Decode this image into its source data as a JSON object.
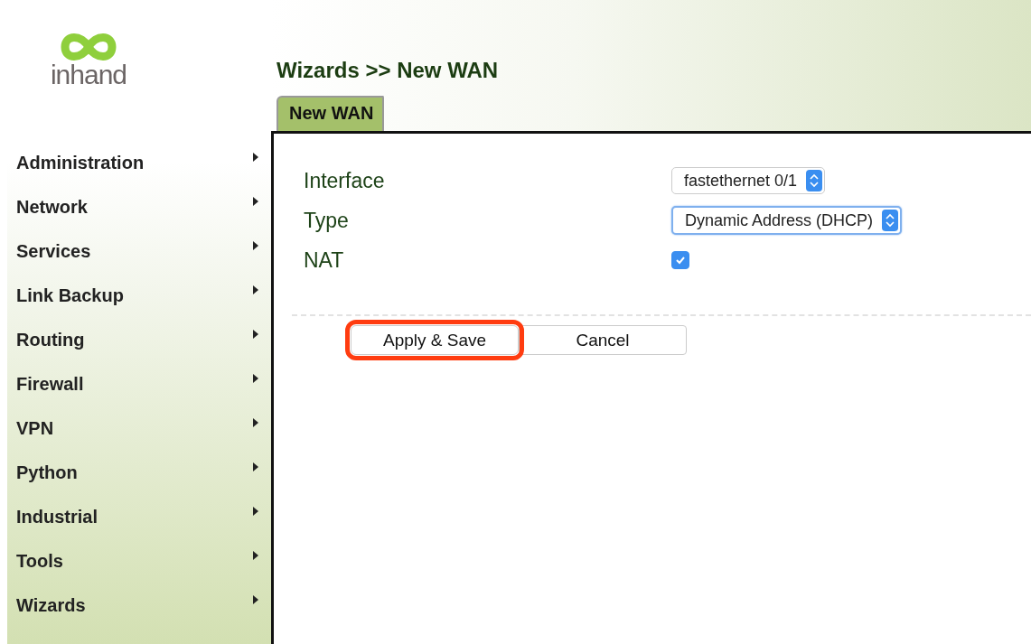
{
  "logo": {
    "text": "inhand"
  },
  "sidebar": {
    "items": [
      {
        "label": "Administration"
      },
      {
        "label": "Network"
      },
      {
        "label": "Services"
      },
      {
        "label": "Link Backup"
      },
      {
        "label": "Routing"
      },
      {
        "label": "Firewall"
      },
      {
        "label": "VPN"
      },
      {
        "label": "Python"
      },
      {
        "label": "Industrial"
      },
      {
        "label": "Tools"
      },
      {
        "label": "Wizards"
      }
    ]
  },
  "page_title": "Wizards >> New WAN",
  "tabs": [
    {
      "label": "New WAN",
      "selected": true
    }
  ],
  "form": {
    "fields": [
      {
        "kind": "select",
        "label": "Interface",
        "value": "fastethernet 0/1",
        "focused": false
      },
      {
        "kind": "select",
        "label": "Type",
        "value": "Dynamic Address (DHCP)",
        "focused": true
      },
      {
        "kind": "checkbox",
        "label": "NAT",
        "checked": true
      }
    ]
  },
  "buttons": [
    {
      "label": "Apply & Save",
      "highlighted": true
    },
    {
      "label": "Cancel",
      "highlighted": false
    }
  ]
}
